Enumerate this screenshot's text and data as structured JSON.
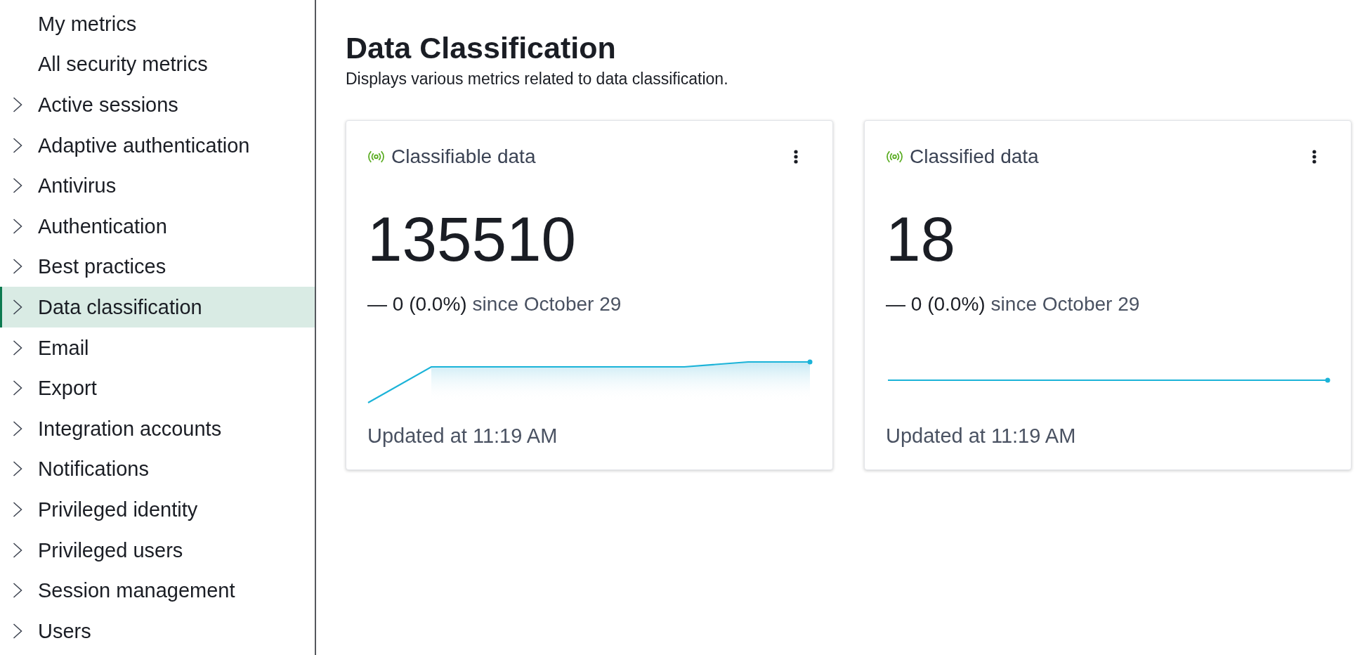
{
  "sidebar": {
    "items": [
      {
        "label": "My metrics",
        "kind": "link",
        "selected": false
      },
      {
        "label": "All security metrics",
        "kind": "link",
        "selected": false
      },
      {
        "label": "Active sessions",
        "kind": "group",
        "expanded": false,
        "selected": false
      },
      {
        "label": "Adaptive authentication",
        "kind": "group",
        "expanded": false,
        "selected": false
      },
      {
        "label": "Antivirus",
        "kind": "group",
        "expanded": false,
        "selected": false
      },
      {
        "label": "Authentication",
        "kind": "group",
        "expanded": false,
        "selected": false
      },
      {
        "label": "Best practices",
        "kind": "group",
        "expanded": false,
        "selected": false
      },
      {
        "label": "Data classification",
        "kind": "group",
        "expanded": false,
        "selected": true
      },
      {
        "label": "Email",
        "kind": "group",
        "expanded": false,
        "selected": false
      },
      {
        "label": "Export",
        "kind": "group",
        "expanded": false,
        "selected": false
      },
      {
        "label": "Integration accounts",
        "kind": "group",
        "expanded": false,
        "selected": false
      },
      {
        "label": "Notifications",
        "kind": "group",
        "expanded": false,
        "selected": false
      },
      {
        "label": "Privileged identity",
        "kind": "group",
        "expanded": false,
        "selected": false
      },
      {
        "label": "Privileged users",
        "kind": "group",
        "expanded": false,
        "selected": false
      },
      {
        "label": "Session management",
        "kind": "group",
        "expanded": false,
        "selected": false
      },
      {
        "label": "Users",
        "kind": "group",
        "expanded": false,
        "selected": false
      }
    ]
  },
  "page": {
    "title": "Data Classification",
    "description": "Displays various metrics related to data classification."
  },
  "cards": [
    {
      "title": "Classifiable data",
      "value": "135510",
      "change": "— 0 (0.0%)",
      "period": "since October 29",
      "updated": "Updated at 11:19 AM"
    },
    {
      "title": "Classified data",
      "value": "18",
      "change": "— 0 (0.0%)",
      "period": "since October 29",
      "updated": "Updated at 11:19 AM"
    }
  ]
}
